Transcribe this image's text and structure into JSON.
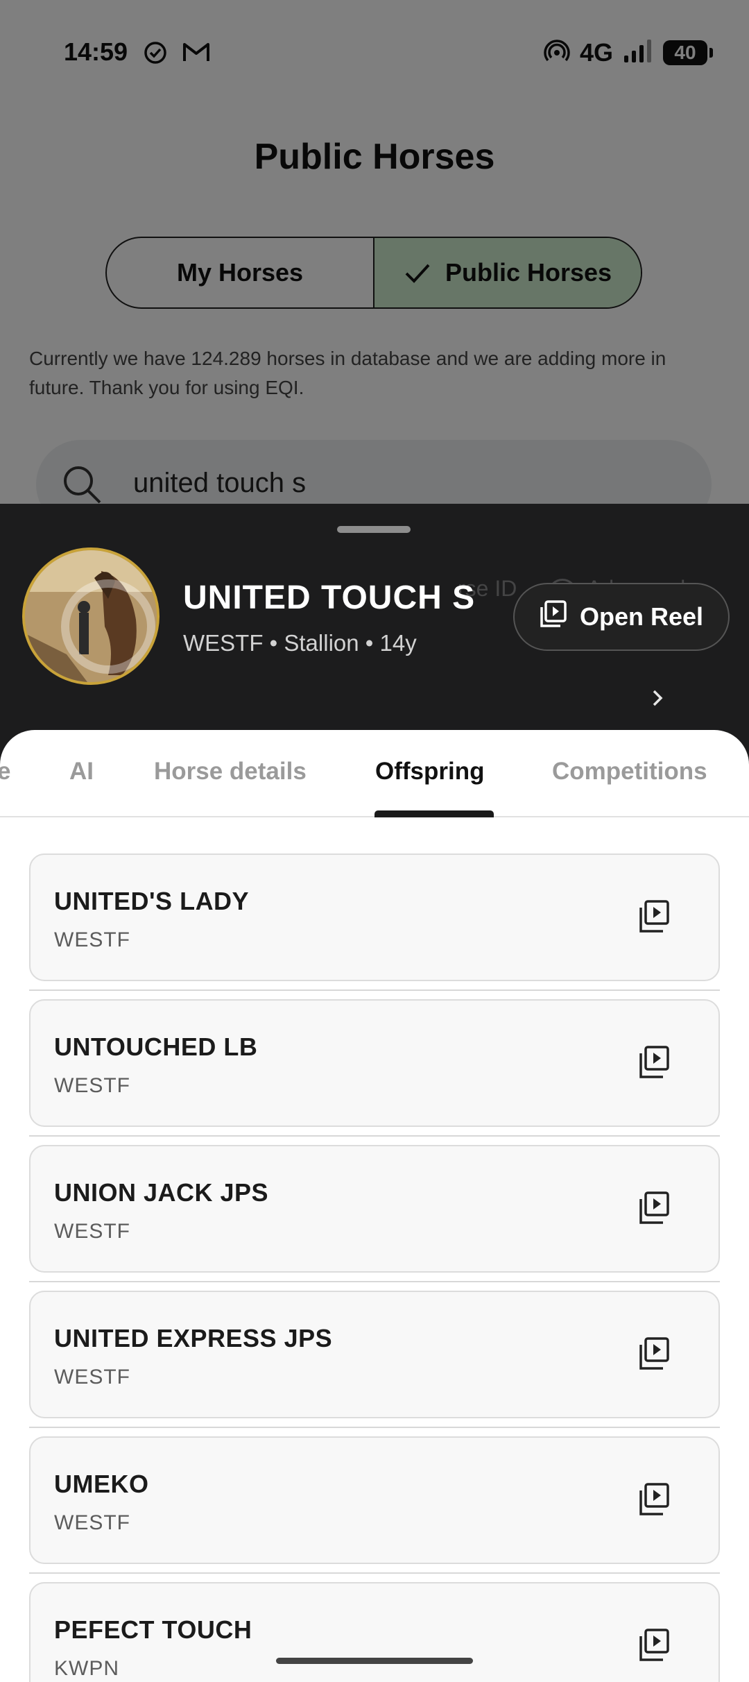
{
  "status_bar": {
    "time": "14:59",
    "network": "4G",
    "battery": "40"
  },
  "page": {
    "title": "Public Horses",
    "segments": [
      {
        "label": "My Horses",
        "selected": false
      },
      {
        "label": "Public Horses",
        "selected": true
      }
    ],
    "info_text": "Currently we have 124.289 horses in database and we are adding more in future. Thank you for using EQI.",
    "search_value": "united touch s"
  },
  "background_peek": {
    "horse_id_label": "rse ID",
    "advanced_label": "Advanced"
  },
  "horse": {
    "name": "UNITED TOUCH S",
    "meta": "WESTF • Stallion • 14y",
    "reel_button": "Open Reel"
  },
  "tabs": [
    {
      "label": "e",
      "active": false
    },
    {
      "label": "AI",
      "active": false
    },
    {
      "label": "Horse details",
      "active": false
    },
    {
      "label": "Offspring",
      "active": true
    },
    {
      "label": "Competitions",
      "active": false
    }
  ],
  "offspring": [
    {
      "name": "UNITED'S LADY",
      "studbook": "WESTF"
    },
    {
      "name": "UNTOUCHED LB",
      "studbook": "WESTF"
    },
    {
      "name": "UNION JACK JPS",
      "studbook": "WESTF"
    },
    {
      "name": "UNITED EXPRESS JPS",
      "studbook": "WESTF"
    },
    {
      "name": "UMEKO",
      "studbook": "WESTF"
    },
    {
      "name": "PEFECT TOUCH",
      "studbook": "KWPN"
    }
  ],
  "colors": {
    "accent_green": "#cfeccf",
    "sheet_dark": "#1c1c1d",
    "avatar_ring": "#c9a339"
  }
}
